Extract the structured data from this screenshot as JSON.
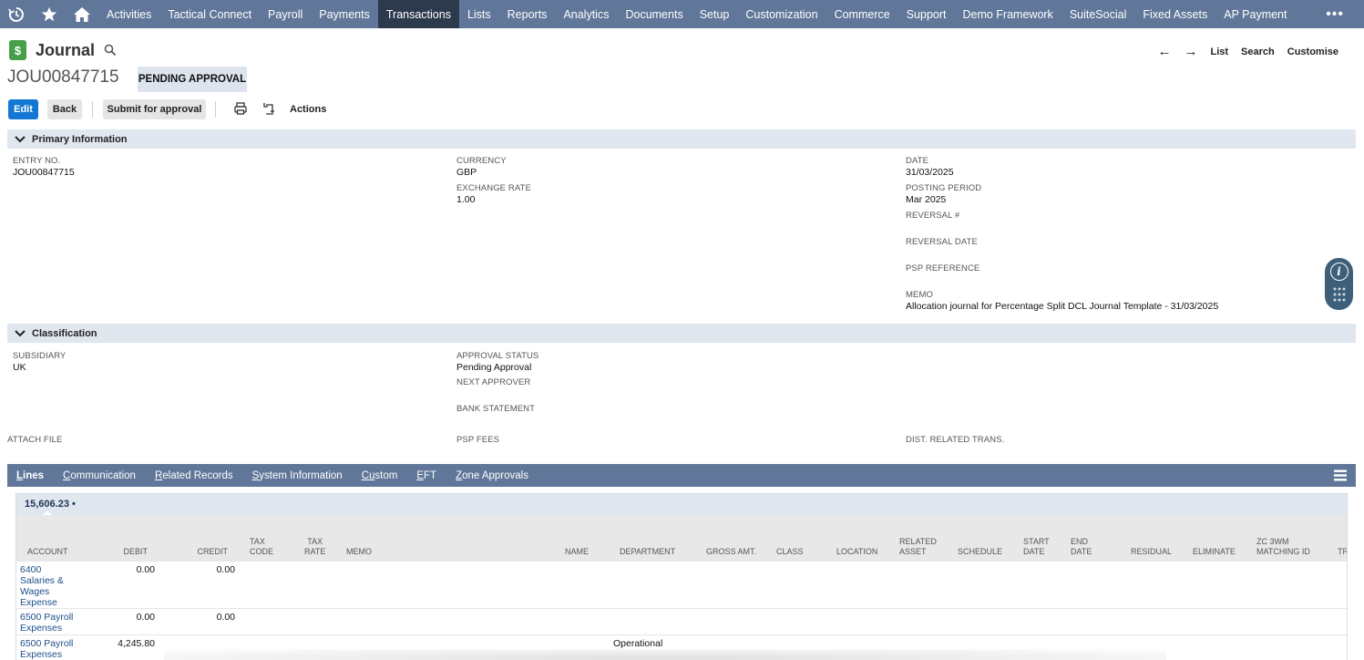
{
  "nav": {
    "items": [
      "Activities",
      "Tactical Connect",
      "Payroll",
      "Payments",
      "Transactions",
      "Lists",
      "Reports",
      "Analytics",
      "Documents",
      "Setup",
      "Customization",
      "Commerce",
      "Support",
      "Demo Framework",
      "SuiteSocial",
      "Fixed Assets",
      "AP Payment"
    ],
    "active_index": 4,
    "more": "•••"
  },
  "record": {
    "type": "Journal",
    "icon_glyph": "$",
    "id": "JOU00847715",
    "status": "PENDING APPROVAL"
  },
  "header_links": {
    "back_arrow": "←",
    "forward_arrow": "→",
    "list": "List",
    "search": "Search",
    "customise": "Customise"
  },
  "toolbar": {
    "edit": "Edit",
    "back": "Back",
    "submit": "Submit for approval",
    "actions": "Actions"
  },
  "primary": {
    "title": "Primary Information",
    "entry_no": {
      "label": "ENTRY NO.",
      "value": "JOU00847715"
    },
    "currency": {
      "label": "CURRENCY",
      "value": "GBP"
    },
    "exchange_rate": {
      "label": "EXCHANGE RATE",
      "value": "1.00"
    },
    "date": {
      "label": "DATE",
      "value": "31/03/2025"
    },
    "posting_period": {
      "label": "POSTING PERIOD",
      "value": "Mar 2025"
    },
    "reversal_no": {
      "label": "REVERSAL #",
      "value": ""
    },
    "reversal_date": {
      "label": "REVERSAL DATE",
      "value": ""
    },
    "psp_reference": {
      "label": "PSP REFERENCE",
      "value": ""
    },
    "memo": {
      "label": "MEMO",
      "value": "Allocation journal for Percentage Split DCL Journal Template - 31/03/2025"
    }
  },
  "classification": {
    "title": "Classification",
    "subsidiary": {
      "label": "SUBSIDIARY",
      "value": "UK"
    },
    "approval_status": {
      "label": "APPROVAL STATUS",
      "value": "Pending Approval"
    },
    "next_approver": {
      "label": "NEXT APPROVER",
      "value": ""
    },
    "bank_statement": {
      "label": "BANK STATEMENT",
      "value": ""
    },
    "attach_file": {
      "label": "ATTACH FILE"
    },
    "psp_fees": {
      "label": "PSP FEES"
    },
    "dist_related": {
      "label": "DIST. RELATED TRANS."
    }
  },
  "subtabs": [
    {
      "first": "L",
      "rest": "ines"
    },
    {
      "first": "C",
      "rest": "ommunication"
    },
    {
      "first": "R",
      "rest": "elated Records"
    },
    {
      "first": "S",
      "rest": "ystem Information"
    },
    {
      "first": "Cu",
      "rest": "stom"
    },
    {
      "first": "E",
      "rest": "FT"
    },
    {
      "first": "Z",
      "rest": "one Approvals"
    }
  ],
  "lines": {
    "total": "15,606.23 •",
    "columns": {
      "account": "ACCOUNT",
      "debit": "DEBIT",
      "credit": "CREDIT",
      "tax_code_1": "TAX",
      "tax_code_2": "CODE",
      "tax_rate_1": "TAX",
      "tax_rate_2": "RATE",
      "memo": "MEMO",
      "name": "NAME",
      "department": "DEPARTMENT",
      "gross_amt": "GROSS AMT.",
      "class": "CLASS",
      "location": "LOCATION",
      "related_asset_1": "RELATED",
      "related_asset_2": "ASSET",
      "schedule": "SCHEDULE",
      "start_date_1": "START",
      "start_date_2": "DATE",
      "end_date_1": "END",
      "end_date_2": "DATE",
      "residual": "RESIDUAL",
      "eliminate": "ELIMINATE",
      "zc_1": "ZC 3WM",
      "zc_2": "MATCHING ID",
      "tr": "TR"
    },
    "rows": [
      {
        "account_lines": [
          "6400",
          "Salaries &",
          "Wages",
          "Expense"
        ],
        "debit": "0.00",
        "credit": "0.00",
        "department": ""
      },
      {
        "account_lines": [
          "6500 Payroll",
          "Expenses"
        ],
        "debit": "0.00",
        "credit": "0.00",
        "department": ""
      },
      {
        "account_lines": [
          "6500 Payroll",
          "Expenses"
        ],
        "debit": "4,245.80",
        "credit": "",
        "department": "Operational"
      }
    ]
  }
}
